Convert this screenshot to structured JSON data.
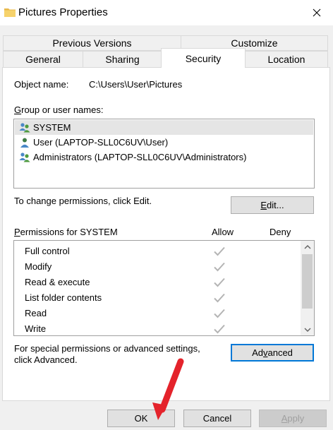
{
  "window": {
    "title": "Pictures Properties"
  },
  "tabs": {
    "back_row": [
      {
        "label": "Previous Versions"
      },
      {
        "label": "Customize"
      }
    ],
    "front_row": [
      {
        "label": "General"
      },
      {
        "label": "Sharing"
      },
      {
        "label": "Security"
      },
      {
        "label": "Location"
      }
    ],
    "active": "Security"
  },
  "object_name": {
    "label": "Object name:",
    "value": "C:\\Users\\User\\Pictures"
  },
  "groups": {
    "label_u": "G",
    "label_rest": "roup or user names:",
    "items": [
      {
        "name": "SYSTEM",
        "selected": true,
        "icon": "group-users-icon"
      },
      {
        "name": "User (LAPTOP-SLL0C6UV\\User)",
        "selected": false,
        "icon": "user-icon"
      },
      {
        "name": "Administrators (LAPTOP-SLL0C6UV\\Administrators)",
        "selected": false,
        "icon": "group-users-icon"
      }
    ]
  },
  "change_text": "To change permissions, click Edit.",
  "edit_button": {
    "u": "E",
    "rest": "dit..."
  },
  "permissions": {
    "label_u": "P",
    "label_rest": "ermissions for SYSTEM",
    "allow_label": "Allow",
    "deny_label": "Deny",
    "items": [
      {
        "name": "Full control",
        "allow": true,
        "deny": false
      },
      {
        "name": "Modify",
        "allow": true,
        "deny": false
      },
      {
        "name": "Read & execute",
        "allow": true,
        "deny": false
      },
      {
        "name": "List folder contents",
        "allow": true,
        "deny": false
      },
      {
        "name": "Read",
        "allow": true,
        "deny": false
      },
      {
        "name": "Write",
        "allow": true,
        "deny": false
      }
    ]
  },
  "special": {
    "line1": "For special permissions or advanced settings,",
    "line2": "click Advanced."
  },
  "advanced_button": {
    "pre": "Ad",
    "u": "v",
    "post": "anced"
  },
  "footer": {
    "ok": "OK",
    "cancel": "Cancel",
    "apply_u": "A",
    "apply_rest": "pply"
  },
  "colors": {
    "accent": "#0078d7",
    "arrow": "#e4232b",
    "check": "#b4b4b4"
  }
}
